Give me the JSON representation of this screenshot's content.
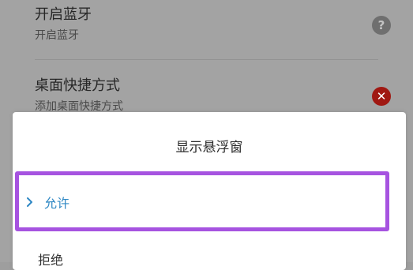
{
  "settings": {
    "bluetooth": {
      "title": "开启蓝牙",
      "subtitle": "开启蓝牙",
      "icon": "help-icon",
      "icon_glyph": "?"
    },
    "shortcut": {
      "title": "桌面快捷方式",
      "subtitle": "添加桌面快捷方式",
      "icon": "error-icon",
      "icon_glyph": "✕"
    }
  },
  "dialog": {
    "title": "显示悬浮窗",
    "options": [
      {
        "label": "允许",
        "selected": true
      },
      {
        "label": "拒绝",
        "selected": false
      }
    ]
  },
  "colors": {
    "selected_text": "#2f88c4",
    "highlight_border": "#a653e0",
    "error_icon": "#a01812",
    "help_icon": "#6f6f6f"
  }
}
